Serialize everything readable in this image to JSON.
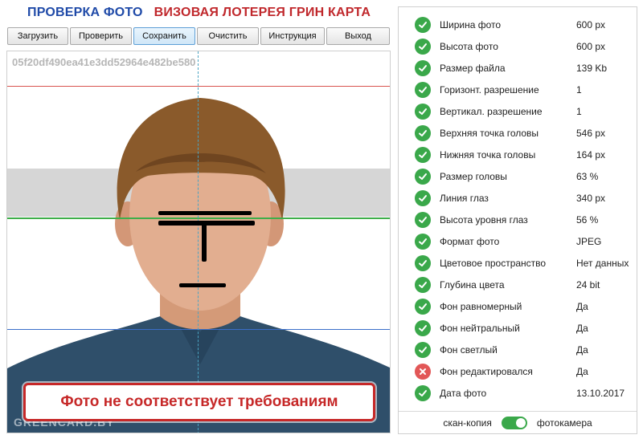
{
  "header": {
    "title_left": "ПРОВЕРКА ФОТО",
    "title_right": "ВИЗОВАЯ ЛОТЕРЕЯ ГРИН КАРТА"
  },
  "toolbar": {
    "buttons": [
      {
        "label": "Загрузить",
        "state": "normal"
      },
      {
        "label": "Проверить",
        "state": "normal"
      },
      {
        "label": "Сохранить",
        "state": "active"
      },
      {
        "label": "Очистить",
        "state": "normal"
      },
      {
        "label": "Инструкция",
        "state": "normal"
      },
      {
        "label": "Выход",
        "state": "normal"
      }
    ]
  },
  "photo": {
    "hash": "05f20df490ea41e3dd52964e482be580",
    "watermark": "GREENCARD.BY",
    "alert": "Фото не соответствует требованиям",
    "guide_colors": {
      "top": "#d9534f",
      "eyes": "#3fae4a",
      "chin": "#3a6ec9",
      "center": "#4aa3c2"
    }
  },
  "results": {
    "items": [
      {
        "label": "Ширина фото",
        "value": "600 px",
        "status": "ok"
      },
      {
        "label": "Высота фото",
        "value": "600 px",
        "status": "ok"
      },
      {
        "label": "Размер файла",
        "value": "139 Kb",
        "status": "ok"
      },
      {
        "label": "Горизонт. разрешение",
        "value": "1",
        "status": "ok"
      },
      {
        "label": "Вертикал. разрешение",
        "value": "1",
        "status": "ok"
      },
      {
        "label": "Верхняя точка головы",
        "value": "546 px",
        "status": "ok"
      },
      {
        "label": "Нижняя точка головы",
        "value": "164 px",
        "status": "ok"
      },
      {
        "label": "Размер головы",
        "value": "63 %",
        "status": "ok"
      },
      {
        "label": "Линия глаз",
        "value": "340 px",
        "status": "ok"
      },
      {
        "label": "Высота уровня глаз",
        "value": "56 %",
        "status": "ok"
      },
      {
        "label": "Формат фото",
        "value": "JPEG",
        "status": "ok"
      },
      {
        "label": "Цветовое пространство",
        "value": "Нет данных",
        "status": "ok"
      },
      {
        "label": "Глубина цвета",
        "value": "24 bit",
        "status": "ok"
      },
      {
        "label": "Фон равномерный",
        "value": "Да",
        "status": "ok"
      },
      {
        "label": "Фон нейтральный",
        "value": "Да",
        "status": "ok"
      },
      {
        "label": "Фон светлый",
        "value": "Да",
        "status": "ok"
      },
      {
        "label": "Фон редактировался",
        "value": "Да",
        "status": "fail"
      },
      {
        "label": "Дата фото",
        "value": "13.10.2017",
        "status": "ok"
      }
    ],
    "toggle": {
      "left_label": "скан-копия",
      "right_label": "фотокамера",
      "on": true
    }
  },
  "colors": {
    "ok": "#3aa84a",
    "fail": "#e25757",
    "title_blue": "#1f4aa8",
    "title_red": "#c0282c",
    "alert_red": "#c62828"
  },
  "icons": {
    "ok": "check-icon",
    "fail": "cross-icon"
  }
}
